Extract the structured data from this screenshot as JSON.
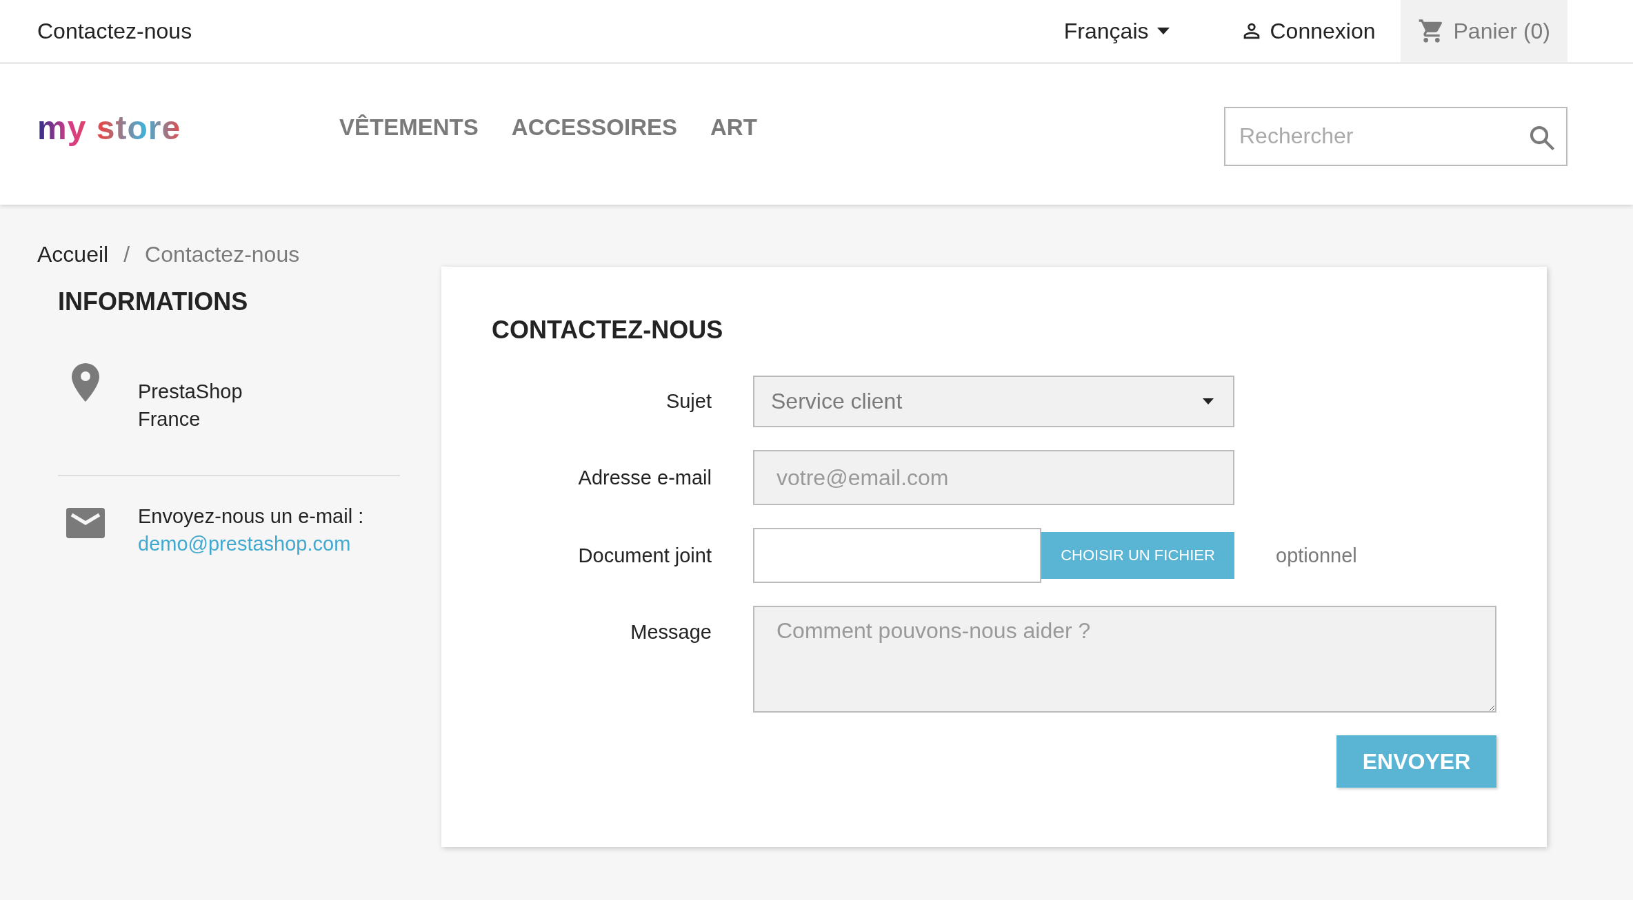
{
  "top_bar": {
    "contact_link": "Contactez-nous",
    "language": "Français",
    "login": "Connexion",
    "cart": "Panier (0)"
  },
  "header": {
    "logo": "my store",
    "nav": [
      "VÊTEMENTS",
      "ACCESSOIRES",
      "ART"
    ],
    "search": {
      "placeholder": "Rechercher"
    }
  },
  "breadcrumb": {
    "items": [
      "Accueil",
      "Contactez-nous"
    ],
    "separator": "/"
  },
  "sidebar": {
    "title": "INFORMATIONS",
    "items": [
      {
        "kind": "address",
        "lines": [
          "PrestaShop",
          "France"
        ]
      },
      {
        "kind": "email",
        "text": "Envoyez-nous un e-mail :",
        "link": "demo@prestashop.com"
      }
    ]
  },
  "form": {
    "title": "CONTACTEZ-NOUS",
    "fields": [
      {
        "kind": "select",
        "label": "Sujet",
        "value": "Service client"
      },
      {
        "kind": "text",
        "label": "Adresse e-mail",
        "placeholder": "votre@email.com"
      },
      {
        "kind": "file",
        "label": "Document joint",
        "button": "CHOISIR UN FICHIER",
        "note": "optionnel"
      },
      {
        "kind": "textarea",
        "label": "Message",
        "placeholder": "Comment pouvons-nous aider ?"
      }
    ],
    "submit": "ENVOYER"
  }
}
